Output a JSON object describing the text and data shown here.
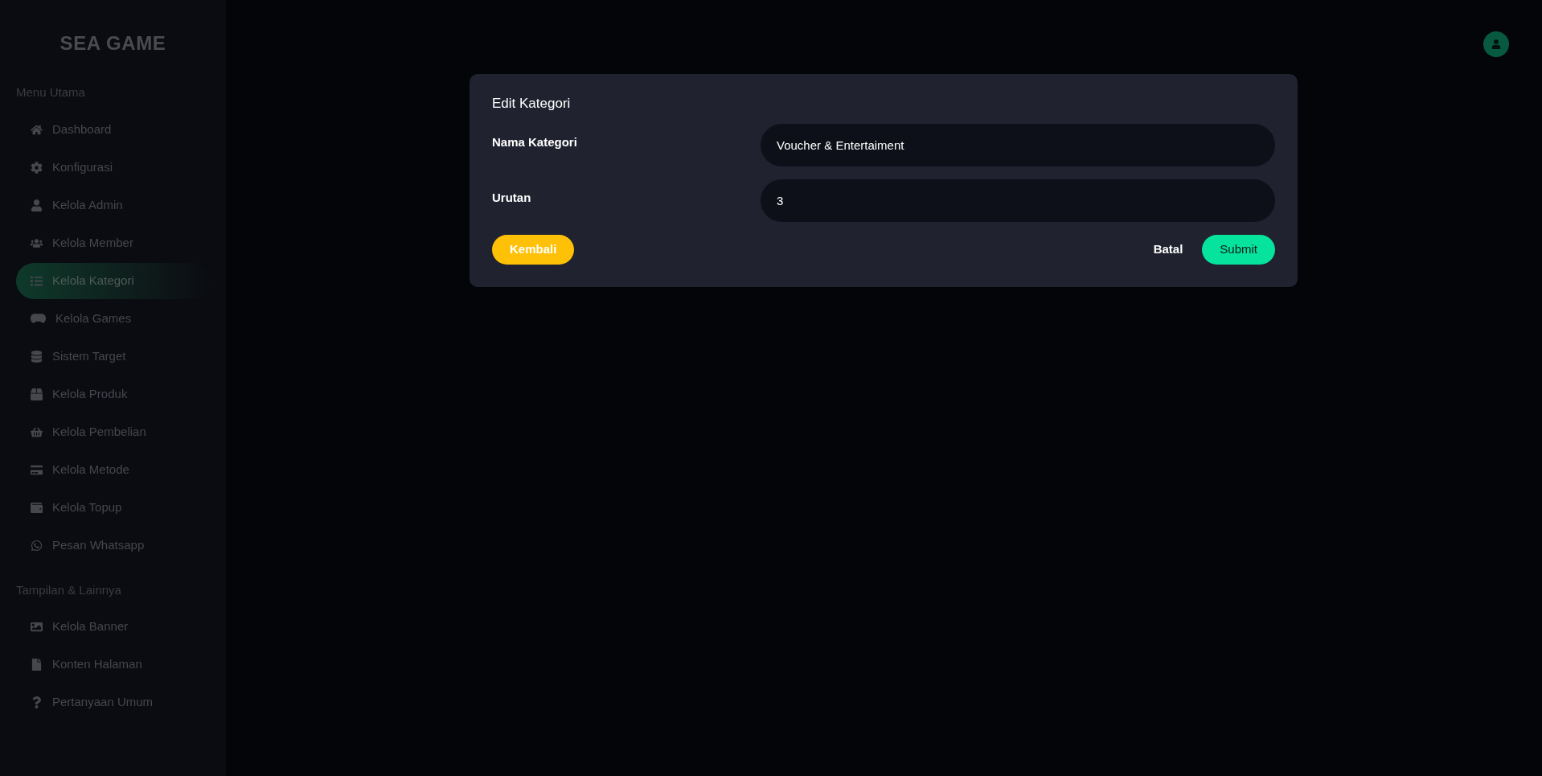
{
  "sidebar": {
    "logo": "SEA GAME",
    "sections": [
      {
        "title": "Menu Utama",
        "items": [
          {
            "label": "Dashboard",
            "selected": false
          },
          {
            "label": "Konfigurasi",
            "selected": false
          },
          {
            "label": "Kelola Admin",
            "selected": false
          },
          {
            "label": "Kelola Member",
            "selected": false
          },
          {
            "label": "Kelola Kategori",
            "selected": true
          },
          {
            "label": "Kelola Games",
            "selected": false
          },
          {
            "label": "Sistem Target",
            "selected": false
          },
          {
            "label": "Kelola Produk",
            "selected": false
          },
          {
            "label": "Kelola Pembelian",
            "selected": false
          },
          {
            "label": "Kelola Metode",
            "selected": false
          },
          {
            "label": "Kelola Topup",
            "selected": false
          },
          {
            "label": "Pesan Whatsapp",
            "selected": false
          }
        ]
      },
      {
        "title": "Tampilan & Lainnya",
        "items": [
          {
            "label": "Kelola Banner",
            "selected": false
          },
          {
            "label": "Konten Halaman",
            "selected": false
          },
          {
            "label": "Pertanyaan Umum",
            "selected": false
          }
        ]
      }
    ]
  },
  "dialog": {
    "title": "Edit Kategori",
    "fields": [
      {
        "label": "Nama Kategori",
        "value": "Voucher & Entertaiment"
      },
      {
        "label": "Urutan",
        "value": "3"
      }
    ],
    "buttons": {
      "back": "Kembali",
      "cancel": "Batal",
      "submit": "Submit"
    }
  }
}
